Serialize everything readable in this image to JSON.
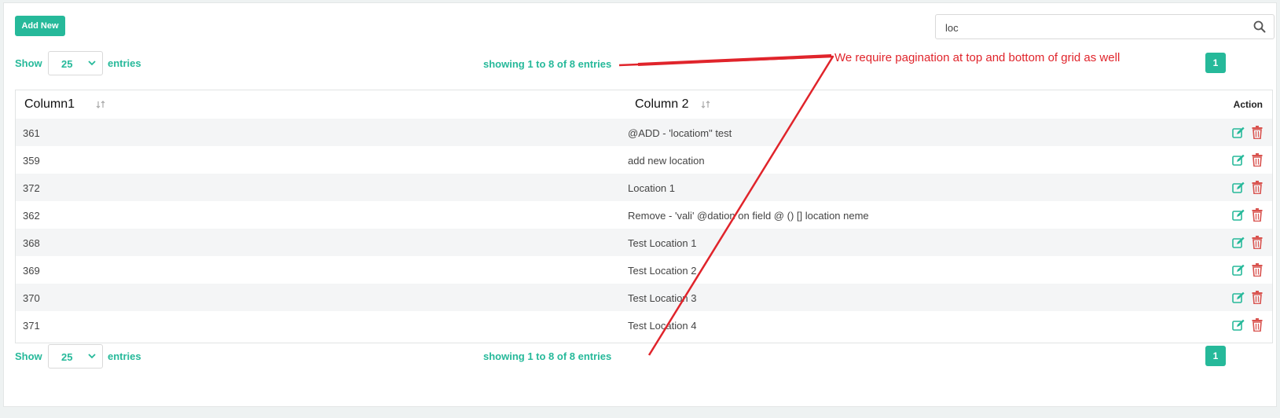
{
  "toolbar": {
    "add_label": "Add New"
  },
  "search": {
    "value": "loc",
    "icon": "search-icon"
  },
  "length_top": {
    "show": "Show",
    "value": "25",
    "entries": "entries"
  },
  "info_top": "showing 1 to 8 of 8 entries",
  "pagination_top": {
    "page": "1"
  },
  "table": {
    "headers": {
      "col1": "Column1",
      "col2": "Column 2",
      "action": "Action"
    },
    "rows": [
      {
        "col1": "361",
        "col2": "@ADD - 'locatiom\" test"
      },
      {
        "col1": "359",
        "col2": "add new location"
      },
      {
        "col1": "372",
        "col2": "Location 1"
      },
      {
        "col1": "362",
        "col2": "Remove - 'vali' @dation on field @ () [] location neme"
      },
      {
        "col1": "368",
        "col2": "Test Location 1"
      },
      {
        "col1": "369",
        "col2": "Test Location 2"
      },
      {
        "col1": "370",
        "col2": "Test Location 3"
      },
      {
        "col1": "371",
        "col2": "Test Location 4"
      }
    ]
  },
  "length_bottom": {
    "show": "Show",
    "value": "25",
    "entries": "entries"
  },
  "info_bottom": "showing 1 to 8 of 8 entries",
  "pagination_bottom": {
    "page": "1"
  },
  "annotation": {
    "text": "We require pagination at top and bottom of grid as well",
    "color": "#e0242b"
  },
  "colors": {
    "accent": "#26b99a",
    "delete": "#d9534f",
    "stripe": "#f4f5f6"
  }
}
